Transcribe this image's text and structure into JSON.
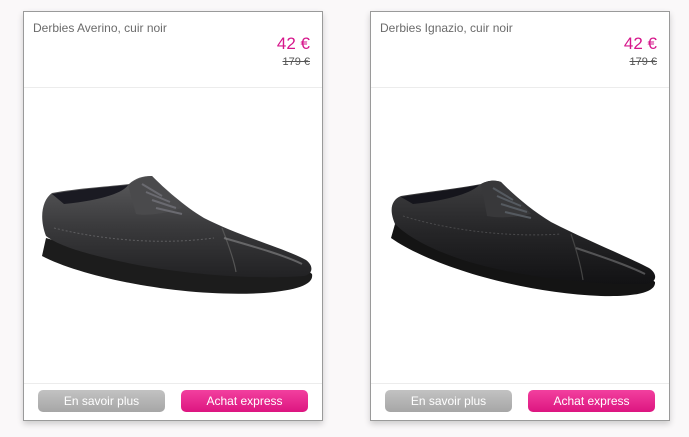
{
  "products": [
    {
      "name": "Derbies Averino, cuir noir",
      "price": "42 €",
      "old_price": "179 €",
      "image_icon": "shoe-image",
      "more_label": "En savoir plus",
      "buy_label": "Achat express"
    },
    {
      "name": "Derbies Ignazio, cuir noir",
      "price": "42 €",
      "old_price": "179 €",
      "image_icon": "shoe-image",
      "more_label": "En savoir plus",
      "buy_label": "Achat express"
    }
  ],
  "colors": {
    "price": "#d6168b",
    "buy_button": "#e8288f",
    "more_button": "#b3b3b3"
  }
}
